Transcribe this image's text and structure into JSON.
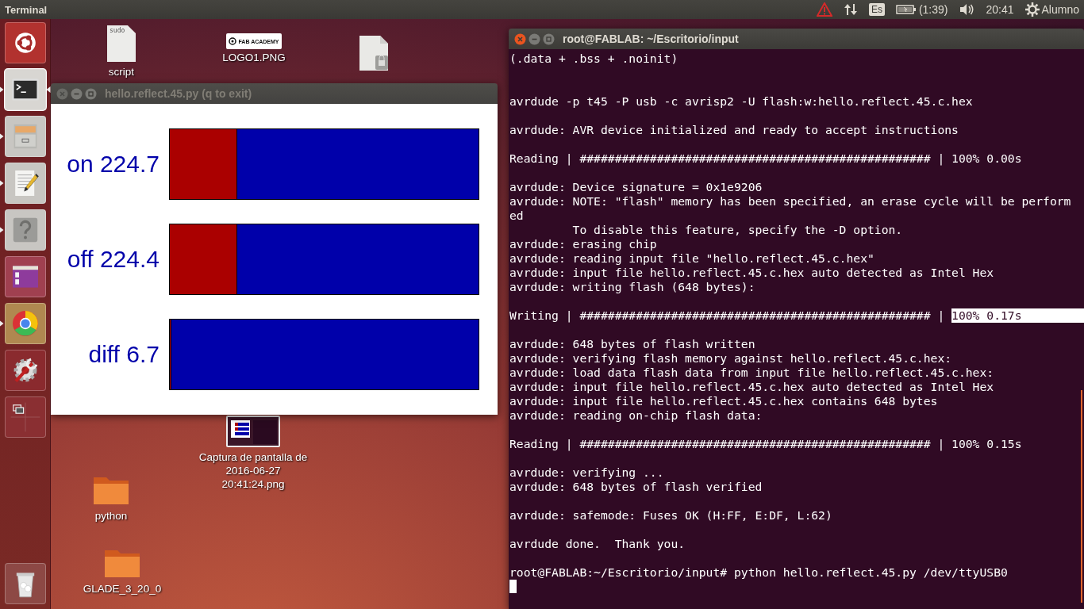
{
  "top_panel": {
    "app_name": "Terminal",
    "keyboard": "Es",
    "battery": "(1:39)",
    "clock": "20:41",
    "user": "Alumno"
  },
  "launcher": [
    {
      "running": false,
      "active": false
    },
    {
      "running": true,
      "active": true
    },
    {
      "running": true,
      "active": false
    },
    {
      "running": true,
      "active": false
    },
    {
      "running": true,
      "active": false
    },
    {
      "running": false,
      "active": false
    },
    {
      "running": true,
      "active": false
    },
    {
      "running": false,
      "active": false
    },
    {
      "running": false,
      "active": false
    },
    {
      "running": false,
      "active": false
    }
  ],
  "desktop_icons": [
    {
      "kind": "text-file",
      "label": "script",
      "thumb_text": "sudo"
    },
    {
      "kind": "logo",
      "label": "LOGO1.PNG",
      "thumb_text": "FAB ACADEMY"
    },
    {
      "kind": "locked-file"
    },
    {
      "kind": "screenshot",
      "label": "Captura de pantalla de 2016-06-27 20:41:24.png"
    },
    {
      "kind": "folder",
      "label": "python"
    },
    {
      "kind": "folder",
      "label": "GLADE_3_20_0"
    }
  ],
  "plot_window": {
    "title": "hello.reflect.45.py (q to exit)",
    "active": false,
    "rows": [
      {
        "label": "on 224.7",
        "level": 0.219
      },
      {
        "label": "off 224.4",
        "level": 0.219
      },
      {
        "label": "diff 6.7",
        "level": 0.006
      }
    ]
  },
  "terminal": {
    "title": "root@FABLAB: ~/Escritorio/input",
    "active": true,
    "lines": [
      {
        "kind": "text",
        "text": "(.data + .bss + .noinit)"
      },
      {
        "kind": "blank"
      },
      {
        "kind": "blank"
      },
      {
        "kind": "text",
        "text": "avrdude -p t45 -P usb -c avrisp2 -U flash:w:hello.reflect.45.c.hex"
      },
      {
        "kind": "blank"
      },
      {
        "kind": "text",
        "text": "avrdude: AVR device initialized and ready to accept instructions"
      },
      {
        "kind": "blank"
      },
      {
        "kind": "text",
        "text": "Reading | ################################################## | 100% 0.00s"
      },
      {
        "kind": "blank"
      },
      {
        "kind": "text",
        "text": "avrdude: Device signature = 0x1e9206"
      },
      {
        "kind": "text",
        "text": "avrdude: NOTE: \"flash\" memory has been specified, an erase cycle will be perform"
      },
      {
        "kind": "text",
        "text": "ed"
      },
      {
        "kind": "text",
        "text": "         To disable this feature, specify the -D option."
      },
      {
        "kind": "text",
        "text": "avrdude: erasing chip"
      },
      {
        "kind": "text",
        "text": "avrdude: reading input file \"hello.reflect.45.c.hex\""
      },
      {
        "kind": "text",
        "text": "avrdude: input file hello.reflect.45.c.hex auto detected as Intel Hex"
      },
      {
        "kind": "text",
        "text": "avrdude: writing flash (648 bytes):"
      },
      {
        "kind": "blank"
      },
      {
        "kind": "text",
        "text": "Writing | ################################################## | ",
        "selection": "100% 0.17s"
      },
      {
        "kind": "blank"
      },
      {
        "kind": "text",
        "text": "avrdude: 648 bytes of flash written"
      },
      {
        "kind": "text",
        "text": "avrdude: verifying flash memory against hello.reflect.45.c.hex:"
      },
      {
        "kind": "text",
        "text": "avrdude: load data flash data from input file hello.reflect.45.c.hex:"
      },
      {
        "kind": "text",
        "text": "avrdude: input file hello.reflect.45.c.hex auto detected as Intel Hex"
      },
      {
        "kind": "text",
        "text": "avrdude: input file hello.reflect.45.c.hex contains 648 bytes"
      },
      {
        "kind": "text",
        "text": "avrdude: reading on-chip flash data:"
      },
      {
        "kind": "blank"
      },
      {
        "kind": "text",
        "text": "Reading | ################################################## | 100% 0.15s"
      },
      {
        "kind": "blank"
      },
      {
        "kind": "text",
        "text": "avrdude: verifying ..."
      },
      {
        "kind": "text",
        "text": "avrdude: 648 bytes of flash verified"
      },
      {
        "kind": "blank"
      },
      {
        "kind": "text",
        "text": "avrdude: safemode: Fuses OK (H:FF, E:DF, L:62)"
      },
      {
        "kind": "blank"
      },
      {
        "kind": "text",
        "text": "avrdude done.  Thank you."
      },
      {
        "kind": "blank"
      },
      {
        "kind": "text",
        "text": "root@FABLAB:~/Escritorio/input# python hello.reflect.45.py /dev/ttyUSB0"
      },
      {
        "kind": "cursor"
      }
    ]
  }
}
